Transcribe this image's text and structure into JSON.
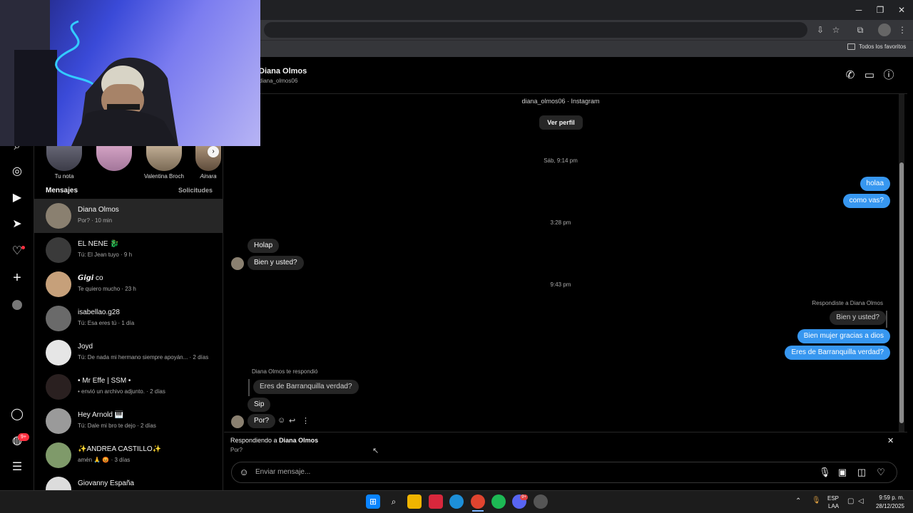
{
  "browser": {
    "bookmarks_folder": "Todos los favoritos"
  },
  "notes": [
    {
      "label": "Tu nota"
    },
    {
      "label": ""
    },
    {
      "label": "Valentina Broch..."
    },
    {
      "label": "Ainara"
    }
  ],
  "inbox": {
    "messages_title": "Mensajes",
    "requests_label": "Solicitudes",
    "conversations": [
      {
        "name": "Diana Olmos",
        "preview": "Por? · 10 min"
      },
      {
        "name": "EL NENE 🐉",
        "preview": "Tú: El Jean tuyo · 9 h"
      },
      {
        "name": "𝙂𝙞𝙜𝙞 co",
        "preview": "Te quiero mucho · 23 h"
      },
      {
        "name": "isabellao.g28",
        "preview": "Tú: Esa eres tú · 1 día"
      },
      {
        "name": "Joyd",
        "preview": "Tú: De nada mi hermano siempre apoyán... · 2 días"
      },
      {
        "name": "• Mr Effe | SSM •",
        "preview": "• envió un archivo adjunto. · 2 días"
      },
      {
        "name": "Hey Arnold 🎹",
        "preview": "Tú: Dale mi bro te dejo · 2 días"
      },
      {
        "name": "✨ANDREA CASTILLO✨",
        "preview": "amén 🙏 😡 · 3 días"
      },
      {
        "name": "Giovanny España",
        "preview": ""
      }
    ]
  },
  "chat": {
    "contact_name": "Diana Olmos",
    "contact_handle": "diana_olmos06",
    "profile_line": "diana_olmos06 · Instagram",
    "view_profile": "Ver perfil",
    "stamps": [
      "Sáb, 9:14 pm",
      "3:28 pm",
      "9:43 pm"
    ],
    "sent_1": [
      "holaa",
      "como vas?"
    ],
    "received_1": [
      "Holap",
      "Bien y usted?"
    ],
    "reply_note_me": "Respondiste a Diana Olmos",
    "quoted_me": "Bien y usted?",
    "sent_2": [
      "Bien mujer gracias a dios",
      "Eres de Barranquilla verdad?"
    ],
    "reply_note_them": "Diana Olmos te respondió",
    "quoted_them": "Eres de Barranquilla verdad?",
    "received_2": [
      "Sip",
      "Por?"
    ]
  },
  "reply_bar": {
    "prefix": "Respondiendo a ",
    "name": "Diana Olmos",
    "quote": "Por?"
  },
  "composer": {
    "placeholder": "Enviar mensaje..."
  },
  "taskbar": {
    "lang": "ESP",
    "lang_sub": "LAA",
    "time": "9:59 p. m.",
    "date": "28/12/2025",
    "badge_discord": "9+",
    "badge_nav": "9+"
  }
}
